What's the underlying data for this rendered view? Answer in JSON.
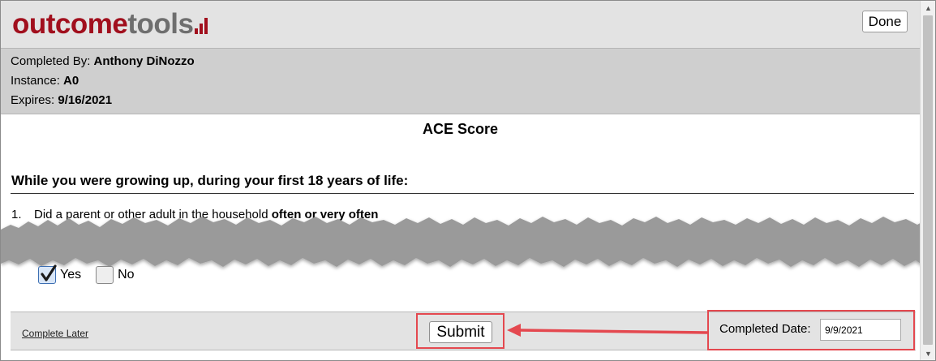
{
  "header": {
    "logo_part1": "outcome",
    "logo_part2": "tools",
    "done_label": "Done"
  },
  "info": {
    "completed_by_label": "Completed By: ",
    "completed_by_value": "Anthony DiNozzo",
    "instance_label": "Instance: ",
    "instance_value": "A0",
    "expires_label": "Expires: ",
    "expires_value": "9/16/2021"
  },
  "main": {
    "title": "ACE Score",
    "section_heading": "While you were growing up, during your first 18 years of life:",
    "question_number": "1.",
    "question_text_start": "Did a parent or other adult in the household ",
    "question_text_bold": "often or very often",
    "options": [
      {
        "label": "Yes",
        "checked": true
      },
      {
        "label": "No",
        "checked": false
      }
    ]
  },
  "footer": {
    "complete_later": "Complete Later",
    "submit_label": "Submit",
    "completed_date_label": "Completed Date:",
    "completed_date_value": "9/9/2021"
  },
  "colors": {
    "brand_red": "#a10f1d",
    "brand_gray": "#6e6e6e",
    "highlight_red": "#e4484f"
  }
}
